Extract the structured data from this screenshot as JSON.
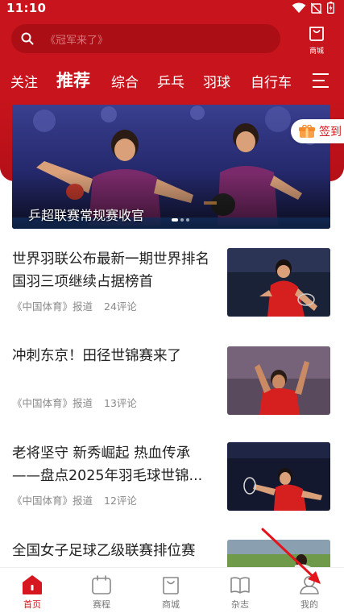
{
  "status_bar": {
    "time": "11:10"
  },
  "search": {
    "placeholder": "《冠军来了》"
  },
  "mall_button": {
    "label": "商城"
  },
  "categories": [
    "关注",
    "推荐",
    "综合",
    "乒乓",
    "羽球",
    "自行车"
  ],
  "active_category": "推荐",
  "banner": {
    "caption": "乒超联赛常规赛收官"
  },
  "checkin": {
    "label": "签到"
  },
  "news": [
    {
      "title": "世界羽联公布最新一期世界排名 国羽三项继续占据榜首",
      "source": "《中国体育》报道",
      "comments": "24评论"
    },
    {
      "title": "冲刺东京！田径世锦赛来了",
      "source": "《中国体育》报道",
      "comments": "13评论"
    },
    {
      "title": "老将坚守 新秀崛起 热血传承——盘点2025年羽毛球世锦...",
      "source": "《中国体育》报道",
      "comments": "12评论"
    },
    {
      "title": "全国女子足球乙级联赛排位赛",
      "source": "",
      "comments": ""
    }
  ],
  "tabs": [
    {
      "label": "首页",
      "icon": "home-icon",
      "active": true
    },
    {
      "label": "赛程",
      "icon": "calendar-icon",
      "active": false
    },
    {
      "label": "商城",
      "icon": "shopping-bag-icon",
      "active": false
    },
    {
      "label": "杂志",
      "icon": "book-icon",
      "active": false
    },
    {
      "label": "我的",
      "icon": "user-icon",
      "active": false
    }
  ],
  "colors": {
    "brand_red": "#c8141c",
    "accent_red": "#d6171f"
  }
}
